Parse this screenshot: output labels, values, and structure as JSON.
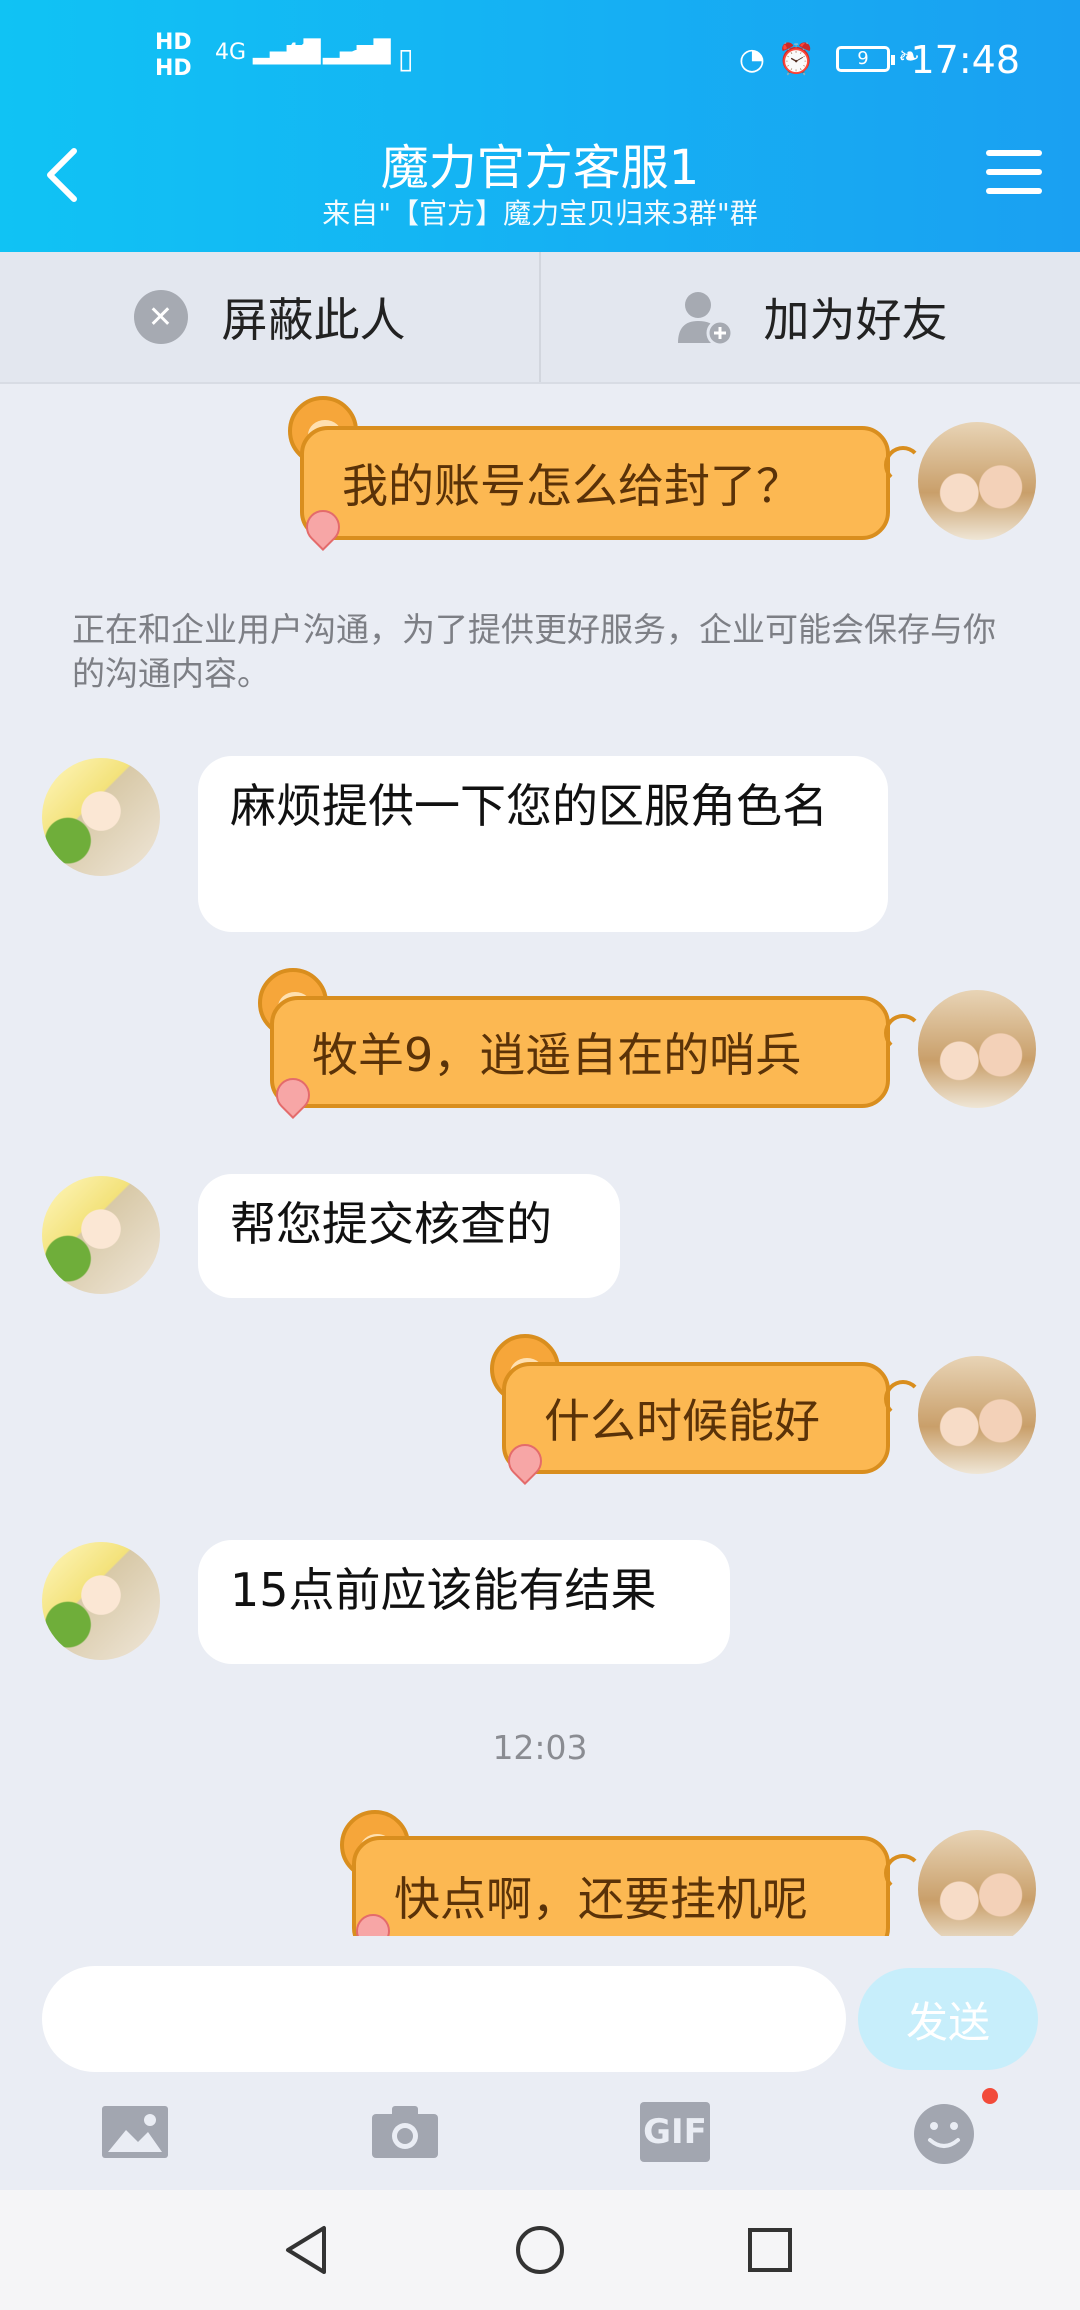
{
  "status_bar": {
    "hd1": "HD",
    "hd2": "HD",
    "net1": "4G",
    "net2": "4G",
    "battery": "9",
    "time": "17:48"
  },
  "header": {
    "title": "魔力官方客服1",
    "subtitle": "来自\"【官方】魔力宝贝归来3群\"群"
  },
  "actions": {
    "block": "屏蔽此人",
    "add_friend": "加为好友"
  },
  "notice": "正在和企业用户沟通，为了提供更好服务，企业可能会保存与你的沟通内容。",
  "messages": [
    {
      "side": "out",
      "text": "我的账号怎么给封了？"
    },
    {
      "side": "in",
      "text": "麻烦提供一下您的区服角色名"
    },
    {
      "side": "out",
      "text": "牧羊9，逍遥自在的哨兵"
    },
    {
      "side": "in",
      "text": "帮您提交核查的"
    },
    {
      "side": "out",
      "text": "什么时候能好"
    },
    {
      "side": "in",
      "text": "15点前应该能有结果"
    },
    {
      "side": "out",
      "text": "快点啊，还要挂机呢"
    }
  ],
  "timestamp": "12:03",
  "input": {
    "value": "",
    "send_label": "发送"
  },
  "tools": {
    "gif_label": "GIF"
  },
  "colors": {
    "header_start": "#10c3f4",
    "header_end": "#1aa0f2",
    "out_bubble": "#fcb852",
    "send_button": "#c7eefb"
  }
}
